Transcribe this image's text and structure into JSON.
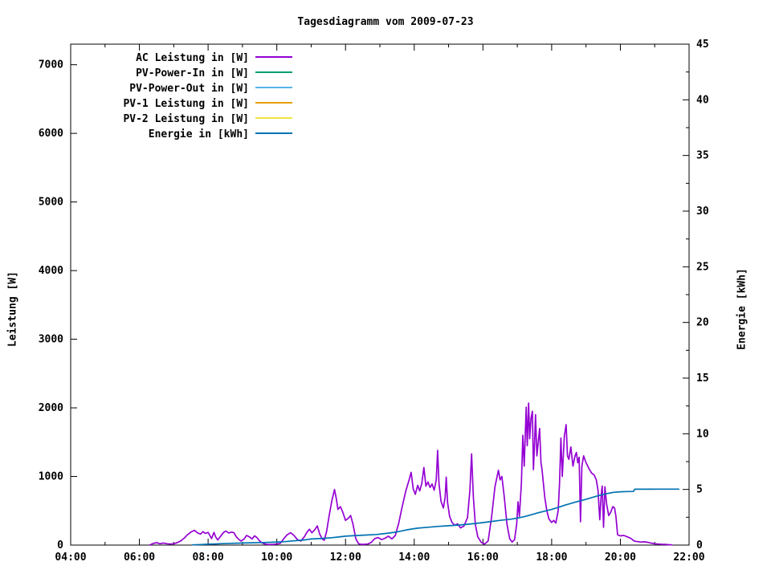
{
  "page": {
    "background": "#ffffff"
  },
  "chart_data": {
    "type": "line",
    "title": "Tagesdiagramm vom 2009-07-23",
    "grid": false,
    "legend_position": "top-left-inside",
    "x_axis": {
      "range_hours": [
        4,
        22
      ],
      "major_step_hours": 2,
      "minor_step_hours": 1,
      "tick_labels": [
        "04:00",
        "06:00",
        "08:00",
        "10:00",
        "12:00",
        "14:00",
        "16:00",
        "18:00",
        "20:00",
        "22:00"
      ]
    },
    "y_left": {
      "label": "Leistung [W]",
      "range": [
        0,
        7300
      ],
      "ticks": [
        0,
        1000,
        2000,
        3000,
        4000,
        5000,
        6000,
        7000
      ]
    },
    "y_right": {
      "label": "Energie [kWh]",
      "range": [
        0,
        45
      ],
      "ticks": [
        0,
        5,
        10,
        15,
        20,
        25,
        30,
        35,
        40,
        45
      ],
      "minor_step": 2.5
    },
    "series": [
      {
        "name": "AC Leistung in [W]",
        "color": "#9400d3",
        "axis": "left",
        "points": [
          [
            6.3,
            0
          ],
          [
            6.4,
            25
          ],
          [
            6.5,
            35
          ],
          [
            6.6,
            20
          ],
          [
            6.7,
            30
          ],
          [
            6.8,
            20
          ],
          [
            6.9,
            15
          ],
          [
            7.0,
            20
          ],
          [
            7.1,
            35
          ],
          [
            7.2,
            60
          ],
          [
            7.3,
            100
          ],
          [
            7.4,
            150
          ],
          [
            7.5,
            190
          ],
          [
            7.6,
            215
          ],
          [
            7.7,
            175
          ],
          [
            7.78,
            160
          ],
          [
            7.85,
            195
          ],
          [
            7.92,
            170
          ],
          [
            8.0,
            185
          ],
          [
            8.05,
            140
          ],
          [
            8.1,
            95
          ],
          [
            8.17,
            185
          ],
          [
            8.22,
            120
          ],
          [
            8.28,
            75
          ],
          [
            8.35,
            120
          ],
          [
            8.45,
            185
          ],
          [
            8.52,
            205
          ],
          [
            8.6,
            175
          ],
          [
            8.68,
            190
          ],
          [
            8.75,
            180
          ],
          [
            8.82,
            120
          ],
          [
            8.9,
            80
          ],
          [
            8.96,
            60
          ],
          [
            9.05,
            90
          ],
          [
            9.12,
            140
          ],
          [
            9.2,
            120
          ],
          [
            9.28,
            90
          ],
          [
            9.35,
            135
          ],
          [
            9.42,
            110
          ],
          [
            9.5,
            60
          ],
          [
            9.6,
            25
          ],
          [
            9.7,
            10
          ],
          [
            9.8,
            8
          ],
          [
            9.9,
            10
          ],
          [
            10.0,
            15
          ],
          [
            10.1,
            25
          ],
          [
            10.2,
            90
          ],
          [
            10.3,
            150
          ],
          [
            10.4,
            180
          ],
          [
            10.5,
            140
          ],
          [
            10.6,
            80
          ],
          [
            10.7,
            60
          ],
          [
            10.8,
            120
          ],
          [
            10.88,
            190
          ],
          [
            10.95,
            230
          ],
          [
            11.02,
            180
          ],
          [
            11.1,
            220
          ],
          [
            11.18,
            280
          ],
          [
            11.25,
            160
          ],
          [
            11.32,
            90
          ],
          [
            11.38,
            70
          ],
          [
            11.45,
            200
          ],
          [
            11.52,
            420
          ],
          [
            11.6,
            640
          ],
          [
            11.68,
            810
          ],
          [
            11.73,
            680
          ],
          [
            11.78,
            520
          ],
          [
            11.85,
            560
          ],
          [
            11.92,
            480
          ],
          [
            12.0,
            360
          ],
          [
            12.08,
            390
          ],
          [
            12.15,
            430
          ],
          [
            12.22,
            300
          ],
          [
            12.3,
            90
          ],
          [
            12.38,
            20
          ],
          [
            12.45,
            10
          ],
          [
            12.55,
            12
          ],
          [
            12.65,
            15
          ],
          [
            12.75,
            40
          ],
          [
            12.85,
            95
          ],
          [
            12.95,
            110
          ],
          [
            13.05,
            80
          ],
          [
            13.15,
            100
          ],
          [
            13.25,
            130
          ],
          [
            13.35,
            90
          ],
          [
            13.45,
            140
          ],
          [
            13.55,
            320
          ],
          [
            13.65,
            560
          ],
          [
            13.75,
            780
          ],
          [
            13.85,
            950
          ],
          [
            13.91,
            1060
          ],
          [
            13.97,
            820
          ],
          [
            14.03,
            740
          ],
          [
            14.1,
            870
          ],
          [
            14.16,
            790
          ],
          [
            14.22,
            900
          ],
          [
            14.28,
            1130
          ],
          [
            14.34,
            860
          ],
          [
            14.4,
            920
          ],
          [
            14.46,
            840
          ],
          [
            14.52,
            890
          ],
          [
            14.58,
            800
          ],
          [
            14.64,
            950
          ],
          [
            14.68,
            1380
          ],
          [
            14.72,
            900
          ],
          [
            14.78,
            640
          ],
          [
            14.85,
            540
          ],
          [
            14.9,
            700
          ],
          [
            14.93,
            990
          ],
          [
            14.97,
            620
          ],
          [
            15.03,
            420
          ],
          [
            15.1,
            330
          ],
          [
            15.18,
            290
          ],
          [
            15.26,
            310
          ],
          [
            15.35,
            250
          ],
          [
            15.45,
            280
          ],
          [
            15.55,
            400
          ],
          [
            15.62,
            800
          ],
          [
            15.67,
            1330
          ],
          [
            15.72,
            700
          ],
          [
            15.78,
            300
          ],
          [
            15.85,
            120
          ],
          [
            15.95,
            40
          ],
          [
            16.05,
            15
          ],
          [
            16.15,
            60
          ],
          [
            16.25,
            400
          ],
          [
            16.35,
            850
          ],
          [
            16.45,
            1090
          ],
          [
            16.5,
            950
          ],
          [
            16.55,
            1000
          ],
          [
            16.62,
            700
          ],
          [
            16.7,
            300
          ],
          [
            16.78,
            90
          ],
          [
            16.85,
            45
          ],
          [
            16.92,
            80
          ],
          [
            16.98,
            300
          ],
          [
            17.02,
            630
          ],
          [
            17.06,
            420
          ],
          [
            17.12,
            900
          ],
          [
            17.16,
            1600
          ],
          [
            17.2,
            1150
          ],
          [
            17.26,
            2010
          ],
          [
            17.29,
            1450
          ],
          [
            17.33,
            2070
          ],
          [
            17.36,
            1550
          ],
          [
            17.4,
            1850
          ],
          [
            17.44,
            1950
          ],
          [
            17.47,
            1100
          ],
          [
            17.5,
            1450
          ],
          [
            17.53,
            1900
          ],
          [
            17.57,
            1300
          ],
          [
            17.61,
            1500
          ],
          [
            17.65,
            1700
          ],
          [
            17.69,
            1200
          ],
          [
            17.72,
            1100
          ],
          [
            17.76,
            900
          ],
          [
            17.8,
            700
          ],
          [
            17.86,
            500
          ],
          [
            17.92,
            380
          ],
          [
            18.0,
            330
          ],
          [
            18.06,
            360
          ],
          [
            18.12,
            320
          ],
          [
            18.19,
            500
          ],
          [
            18.23,
            900
          ],
          [
            18.27,
            1560
          ],
          [
            18.31,
            1000
          ],
          [
            18.37,
            1590
          ],
          [
            18.42,
            1755
          ],
          [
            18.46,
            1300
          ],
          [
            18.5,
            1250
          ],
          [
            18.56,
            1430
          ],
          [
            18.62,
            1150
          ],
          [
            18.68,
            1300
          ],
          [
            18.72,
            1350
          ],
          [
            18.76,
            1200
          ],
          [
            18.8,
            1280
          ],
          [
            18.84,
            340
          ],
          [
            18.88,
            1150
          ],
          [
            18.93,
            1300
          ],
          [
            19.0,
            1200
          ],
          [
            19.08,
            1120
          ],
          [
            19.16,
            1050
          ],
          [
            19.24,
            1020
          ],
          [
            19.3,
            950
          ],
          [
            19.35,
            800
          ],
          [
            19.4,
            370
          ],
          [
            19.44,
            720
          ],
          [
            19.47,
            860
          ],
          [
            19.51,
            260
          ],
          [
            19.55,
            850
          ],
          [
            19.6,
            600
          ],
          [
            19.66,
            430
          ],
          [
            19.72,
            480
          ],
          [
            19.78,
            560
          ],
          [
            19.83,
            540
          ],
          [
            19.87,
            420
          ],
          [
            19.92,
            150
          ],
          [
            20.0,
            135
          ],
          [
            20.1,
            140
          ],
          [
            20.2,
            120
          ],
          [
            20.3,
            100
          ],
          [
            20.4,
            60
          ],
          [
            20.5,
            50
          ],
          [
            20.6,
            45
          ],
          [
            20.7,
            48
          ],
          [
            20.8,
            40
          ],
          [
            20.9,
            28
          ],
          [
            21.0,
            20
          ],
          [
            21.1,
            15
          ],
          [
            21.2,
            12
          ],
          [
            21.3,
            10
          ],
          [
            21.4,
            6
          ],
          [
            21.5,
            4
          ]
        ]
      },
      {
        "name": "PV-Power-In in [W]",
        "color": "#009e73",
        "axis": "left",
        "points": []
      },
      {
        "name": "PV-Power-Out in [W]",
        "color": "#56b4e9",
        "axis": "left",
        "points": []
      },
      {
        "name": "PV-1 Leistung in [W]",
        "color": "#e69f00",
        "axis": "left",
        "points": []
      },
      {
        "name": "PV-2 Leistung in [W]",
        "color": "#f0e442",
        "axis": "left",
        "points": []
      },
      {
        "name": "Energie in [kWh]",
        "color": "#0072b2",
        "axis": "right",
        "points": [
          [
            7.55,
            0.02
          ],
          [
            7.8,
            0.05
          ],
          [
            8.0,
            0.08
          ],
          [
            8.2,
            0.1
          ],
          [
            8.4,
            0.13
          ],
          [
            8.7,
            0.16
          ],
          [
            9.0,
            0.19
          ],
          [
            9.3,
            0.21
          ],
          [
            9.6,
            0.23
          ],
          [
            9.9,
            0.26
          ],
          [
            10.2,
            0.3
          ],
          [
            10.5,
            0.38
          ],
          [
            10.8,
            0.46
          ],
          [
            11.0,
            0.55
          ],
          [
            11.2,
            0.58
          ],
          [
            11.4,
            0.61
          ],
          [
            11.6,
            0.66
          ],
          [
            11.8,
            0.73
          ],
          [
            12.0,
            0.8
          ],
          [
            12.3,
            0.86
          ],
          [
            12.6,
            0.9
          ],
          [
            12.9,
            0.95
          ],
          [
            13.2,
            1.05
          ],
          [
            13.5,
            1.18
          ],
          [
            13.8,
            1.38
          ],
          [
            14.1,
            1.52
          ],
          [
            14.4,
            1.6
          ],
          [
            14.7,
            1.68
          ],
          [
            15.0,
            1.74
          ],
          [
            15.3,
            1.8
          ],
          [
            15.6,
            1.88
          ],
          [
            15.9,
            1.98
          ],
          [
            16.2,
            2.1
          ],
          [
            16.5,
            2.22
          ],
          [
            16.8,
            2.32
          ],
          [
            17.0,
            2.42
          ],
          [
            17.2,
            2.55
          ],
          [
            17.4,
            2.72
          ],
          [
            17.6,
            2.9
          ],
          [
            17.8,
            3.05
          ],
          [
            18.0,
            3.2
          ],
          [
            18.2,
            3.4
          ],
          [
            18.4,
            3.6
          ],
          [
            18.6,
            3.78
          ],
          [
            18.8,
            3.95
          ],
          [
            19.0,
            4.12
          ],
          [
            19.2,
            4.3
          ],
          [
            19.4,
            4.48
          ],
          [
            19.6,
            4.62
          ],
          [
            19.8,
            4.74
          ],
          [
            20.0,
            4.79
          ],
          [
            20.2,
            4.81
          ],
          [
            20.38,
            4.82
          ],
          [
            20.42,
            5.02
          ],
          [
            20.8,
            5.02
          ],
          [
            21.2,
            5.03
          ],
          [
            21.7,
            5.03
          ]
        ]
      }
    ]
  }
}
